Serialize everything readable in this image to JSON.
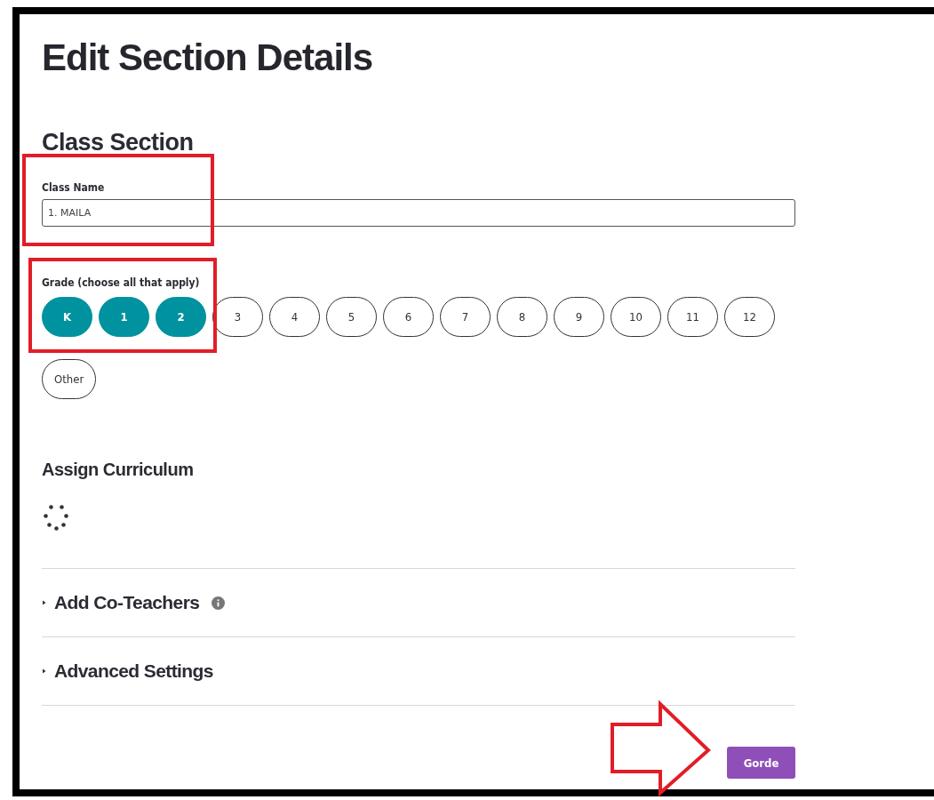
{
  "title": "Edit Section Details",
  "section_heading": "Class Section",
  "class_name": {
    "label": "Class Name",
    "value": "1. MAILA"
  },
  "grades": {
    "label": "Grade (choose all that apply)",
    "options": [
      {
        "label": "K",
        "selected": true
      },
      {
        "label": "1",
        "selected": true
      },
      {
        "label": "2",
        "selected": true
      },
      {
        "label": "3",
        "selected": false
      },
      {
        "label": "4",
        "selected": false
      },
      {
        "label": "5",
        "selected": false
      },
      {
        "label": "6",
        "selected": false
      },
      {
        "label": "7",
        "selected": false
      },
      {
        "label": "8",
        "selected": false
      },
      {
        "label": "9",
        "selected": false
      },
      {
        "label": "10",
        "selected": false
      },
      {
        "label": "11",
        "selected": false
      },
      {
        "label": "12",
        "selected": false
      },
      {
        "label": "Other",
        "selected": false
      }
    ]
  },
  "curriculum": {
    "heading": "Assign Curriculum",
    "loading": true
  },
  "collapsibles": [
    {
      "label": "Add Co-Teachers",
      "expanded": false,
      "info": true
    },
    {
      "label": "Advanced Settings",
      "expanded": false,
      "info": false
    }
  ],
  "save_button": "Gorde",
  "annotations": [
    {
      "kind": "box"
    },
    {
      "kind": "box"
    },
    {
      "kind": "arrow"
    }
  ]
}
